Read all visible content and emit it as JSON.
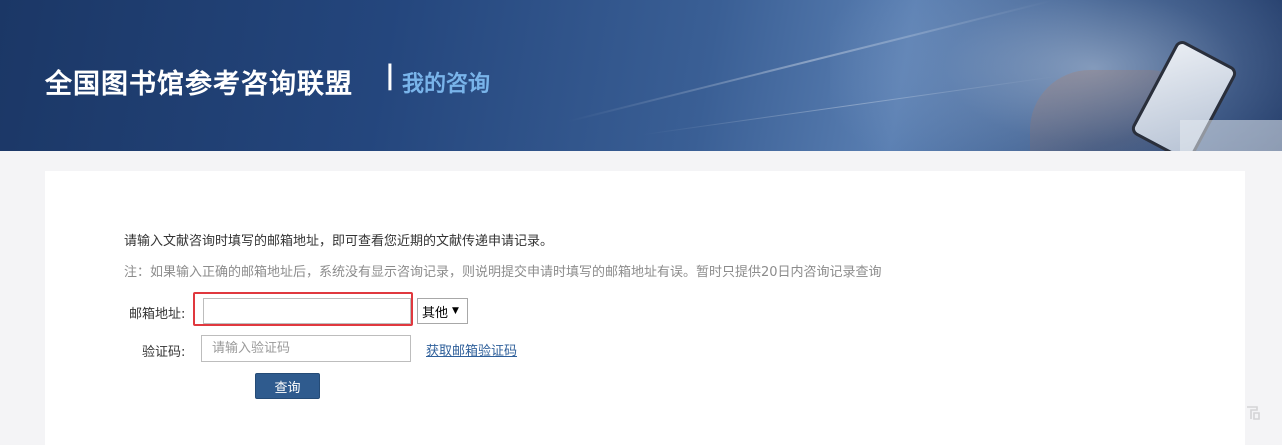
{
  "header": {
    "site_title": "全国图书馆参考咨询联盟",
    "separator": "|",
    "sub_title": "我的咨询"
  },
  "content": {
    "intro_text": "请输入文献咨询时填写的邮箱地址，即可查看您近期的文献传递申请记录。",
    "note_text": "注：如果输入正确的邮箱地址后，系统没有显示咨询记录，则说明提交申请时填写的邮箱地址有误。暂时只提供20日内咨询记录查询"
  },
  "form": {
    "email_label": "邮箱地址:",
    "email_value": "",
    "email_highlight_color": "#e0383e",
    "domain_select_value": "其他",
    "code_label": "验证码:",
    "code_placeholder": "请输入验证码",
    "get_code_link": "获取邮箱验证码",
    "query_button": "查询"
  },
  "colors": {
    "banner_blue": "#24467d",
    "sub_title": "#79b4ea",
    "button": "#2f5b8e",
    "link": "#2e5f9a"
  }
}
